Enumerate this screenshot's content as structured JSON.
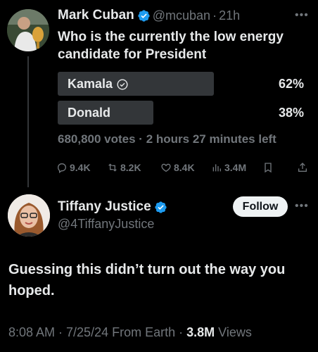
{
  "tweet": {
    "author_name": "Mark Cuban",
    "handle": "@mcuban",
    "separator": "·",
    "time": "21h",
    "text": "Who is the currently the low energy candidate for President",
    "poll": {
      "options": [
        {
          "label": "Kamala",
          "percent": "62%",
          "share": 0.62,
          "selected": true
        },
        {
          "label": "Donald",
          "percent": "38%",
          "share": 0.38,
          "selected": false
        }
      ],
      "meta": "680,800 votes · 2 hours 27 minutes left"
    },
    "actions": {
      "replies": "9.4K",
      "reposts": "8.2K",
      "likes": "8.4K",
      "views": "3.4M"
    }
  },
  "reply": {
    "author_name": "Tiffany Justice",
    "handle": "@4TiffanyJustice",
    "follow_label": "Follow",
    "text": "Guessing this didn’t turn out the way you hoped.",
    "footer_meta": "8:08 AM · 7/25/24 From Earth · ",
    "footer_views_count": "3.8M",
    "footer_views_label": " Views"
  },
  "colors": {
    "background": "#000000",
    "verified_blue": "#1d9bf0",
    "poll_bar": "#333639",
    "muted_text": "#71767b"
  }
}
